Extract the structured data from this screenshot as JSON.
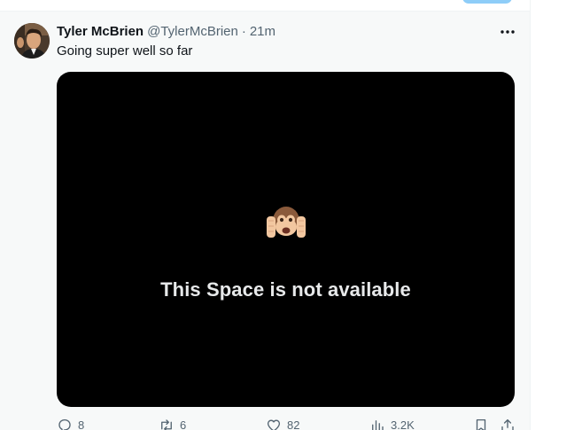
{
  "tweet": {
    "author_name": "Tyler McBrien",
    "author_handle": "@TylerMcBrien",
    "separator": "·",
    "timestamp": "21m",
    "text": "Going super well so far",
    "more_icon": "more-horizontal-icon",
    "avatar_icon": "profile-photo"
  },
  "space_card": {
    "icon": "hear-no-evil-monkey-icon",
    "message": "This Space is not available",
    "background": "#000000"
  },
  "actions": {
    "replies": "8",
    "reposts": "6",
    "likes": "82",
    "views": "3.2K",
    "reply_icon": "reply-icon",
    "repost_icon": "repost-icon",
    "like_icon": "heart-icon",
    "views_icon": "views-icon",
    "bookmark_icon": "bookmark-icon",
    "share_icon": "share-icon"
  },
  "colors": {
    "primary_text": "#0f1419",
    "secondary_text": "#536471",
    "background": "#f7f9f9",
    "accent_pill": "#8ecdf8"
  }
}
